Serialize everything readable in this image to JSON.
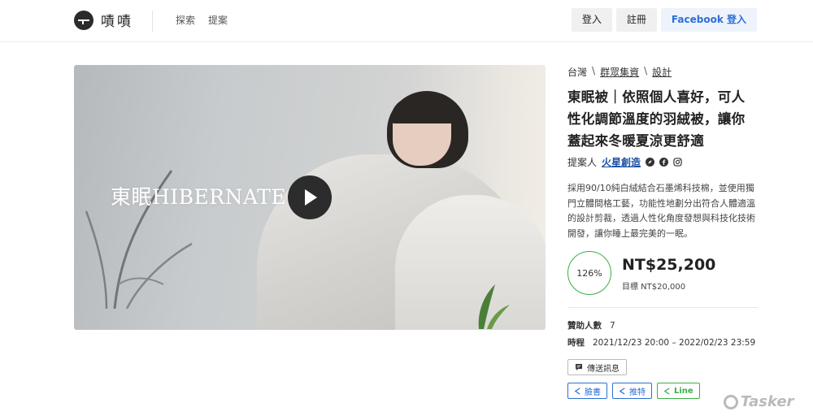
{
  "header": {
    "logo_text": "嘖嘖",
    "nav": [
      "探索",
      "提案"
    ],
    "login_label": "登入",
    "register_label": "註冊",
    "facebook_login_label": "Facebook 登入"
  },
  "video": {
    "brand_logo_text": "東眠HIBERNATE"
  },
  "project": {
    "breadcrumb": [
      "台灣",
      "群眾集資",
      "設計"
    ],
    "breadcrumb_sep": "\\",
    "title": "東眠被｜依照個人喜好，可人性化調節溫度的羽絨被，讓你蓋起來冬暖夏涼更舒適",
    "proposer_label": "提案人",
    "proposer_name": "火星創造",
    "description": "採用90/10純白絨結合石墨烯科技棉，並使用獨門立體間格工藝，功能性地劃分出符合人體適溫的設計剪裁，透過人性化角度發想與科技化技術開發，讓你睡上最完美的一眠。",
    "progress_percent": "126%",
    "amount": "NT$25,200",
    "goal": "目標 NT$20,000",
    "backers_label": "贊助人數",
    "backers_value": "7",
    "schedule_label": "時程",
    "schedule_value": "2021/12/23 20:00 – 2022/02/23 23:59",
    "message_button": "傳送訊息",
    "share_facebook": "臉書",
    "share_twitter": "推特",
    "share_line": "Line"
  },
  "watermark": "Tasker",
  "colors": {
    "progress_ring": "#3cae45",
    "link_blue": "#1a4fa3",
    "facebook_blue": "#2d6fd6",
    "line_green": "#3cae45"
  }
}
